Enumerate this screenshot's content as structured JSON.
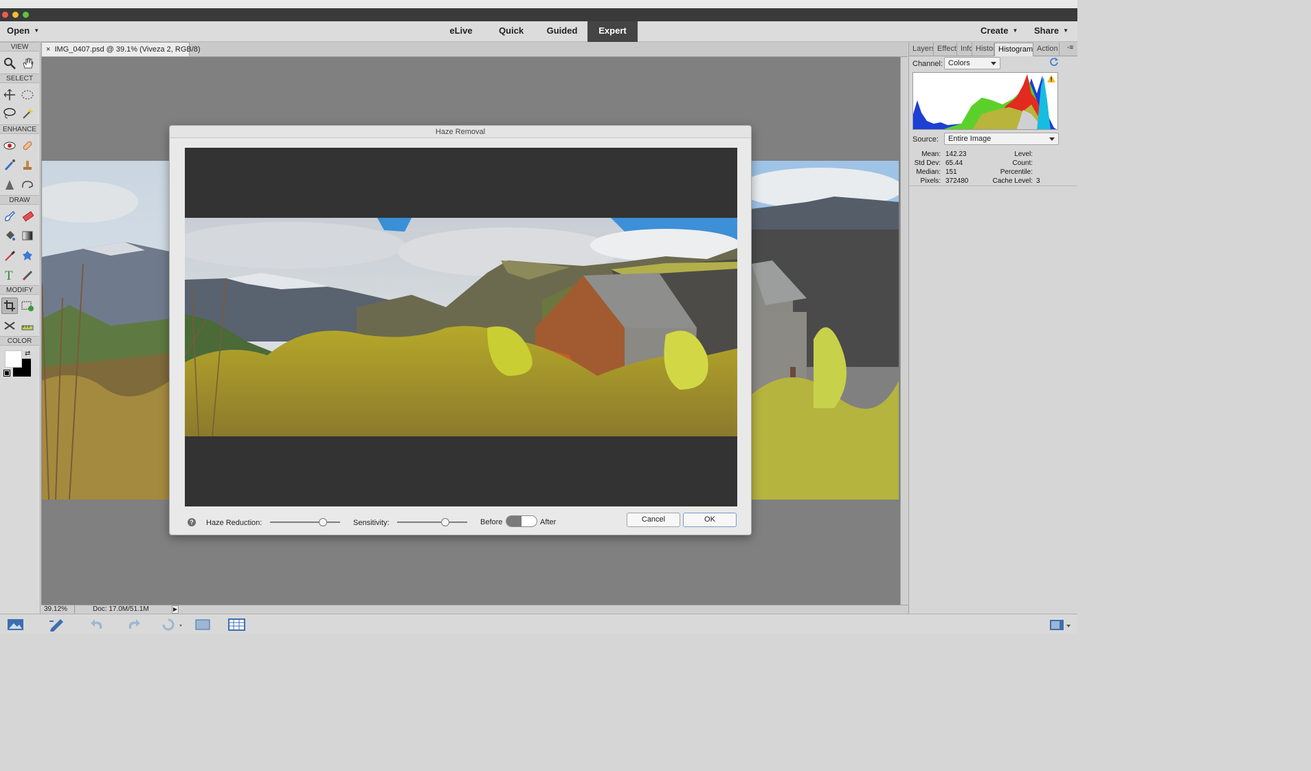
{
  "menubar": {
    "open": "Open",
    "modes": [
      "eLive",
      "Quick",
      "Guided",
      "Expert"
    ],
    "active_mode": "Expert",
    "create": "Create",
    "share": "Share"
  },
  "toolbar": {
    "sections": [
      "VIEW",
      "SELECT",
      "ENHANCE",
      "DRAW",
      "MODIFY",
      "COLOR"
    ],
    "tools": {
      "view": [
        "zoom-icon",
        "hand-icon"
      ],
      "select": [
        "move-icon",
        "marquee-icon",
        "lasso-icon",
        "magic-wand-icon"
      ],
      "enhance": [
        "red-eye-icon",
        "spot-healing-icon",
        "smart-brush-icon",
        "clone-stamp-icon",
        "blur-icon",
        "sponge-icon"
      ],
      "draw": [
        "brush-icon",
        "eraser-icon",
        "paint-bucket-icon",
        "gradient-icon",
        "eyedropper-icon",
        "custom-shape-icon",
        "type-icon",
        "pencil-icon"
      ],
      "modify": [
        "crop-icon",
        "recompose-icon",
        "content-aware-move-icon",
        "straighten-icon"
      ]
    },
    "foreground": "#ffffff",
    "background": "#000000"
  },
  "document": {
    "tab_title": "IMG_0407.psd @ 39.1% (Viveza 2, RGB/8)",
    "zoom": "39.12%",
    "doc_size": "Doc: 17.0M/51.1M"
  },
  "panel": {
    "tabs": [
      "Layers",
      "Effects",
      "Info",
      "Histor",
      "Histogram",
      "Action"
    ],
    "active_tab": "Histogram",
    "channel_label": "Channel:",
    "channel_value": "Colors",
    "source_label": "Source:",
    "source_value": "Entire Image",
    "stats": {
      "mean_label": "Mean:",
      "mean": "142.23",
      "std_label": "Std Dev:",
      "std": "65.44",
      "median_label": "Median:",
      "median": "151",
      "pixels_label": "Pixels:",
      "pixels": "372480",
      "level_label": "Level:",
      "level": "",
      "count_label": "Count:",
      "count": "",
      "percentile_label": "Percentile:",
      "percentile": "",
      "cache_label": "Cache Level:",
      "cache": "3"
    }
  },
  "dialog": {
    "title": "Haze Removal",
    "haze_label": "Haze Reduction:",
    "haze_value": 0.75,
    "sensitivity_label": "Sensitivity:",
    "sensitivity_value": 0.69,
    "before_label": "Before",
    "after_label": "After",
    "cancel": "Cancel",
    "ok": "OK"
  }
}
